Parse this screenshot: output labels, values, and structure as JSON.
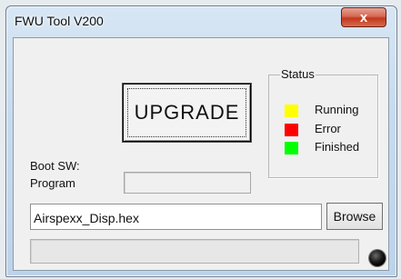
{
  "window": {
    "title": "FWU Tool V200",
    "close_label": "x"
  },
  "upgrade_button": {
    "label": "UPGRADE"
  },
  "status": {
    "caption": "Status",
    "items": [
      {
        "label": "Running",
        "color": "#ffff00"
      },
      {
        "label": "Error",
        "color": "#ff0000"
      },
      {
        "label": "Finished",
        "color": "#00ff00"
      }
    ]
  },
  "labels": {
    "boot_sw": "Boot SW:",
    "program": "Program"
  },
  "file_field": {
    "value": "Airspexx_Disp.hex"
  },
  "browse_button": {
    "label": "Browse"
  },
  "progress": {
    "value": 0
  },
  "indicator": {
    "color": "#000000"
  }
}
